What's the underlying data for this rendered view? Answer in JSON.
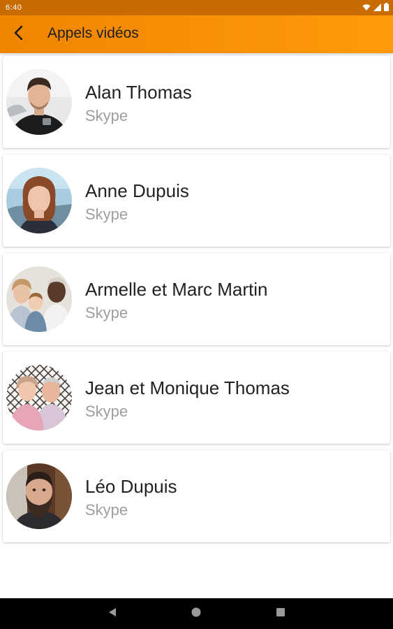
{
  "status_bar": {
    "time": "6:40",
    "icons": [
      "wifi-icon",
      "signal-icon",
      "battery-icon"
    ]
  },
  "app_bar": {
    "title": "Appels vidéos",
    "back_icon": "back-arrow-icon"
  },
  "colors": {
    "accent": "#ff8c00",
    "status_bar": "#c86b00",
    "name_text": "#222222",
    "service_text": "#9e9e9e"
  },
  "contacts": [
    {
      "name": "Alan Thomas",
      "service": "Skype",
      "avatar": "avatar-alan-thomas"
    },
    {
      "name": "Anne Dupuis",
      "service": "Skype",
      "avatar": "avatar-anne-dupuis"
    },
    {
      "name": "Armelle et Marc Martin",
      "service": "Skype",
      "avatar": "avatar-armelle-marc-martin"
    },
    {
      "name": "Jean et Monique Thomas",
      "service": "Skype",
      "avatar": "avatar-jean-monique-thomas"
    },
    {
      "name": "Léo Dupuis",
      "service": "Skype",
      "avatar": "avatar-leo-dupuis"
    }
  ],
  "nav_bar": {
    "icons": [
      "back-triangle-icon",
      "home-circle-icon",
      "recents-square-icon"
    ]
  }
}
